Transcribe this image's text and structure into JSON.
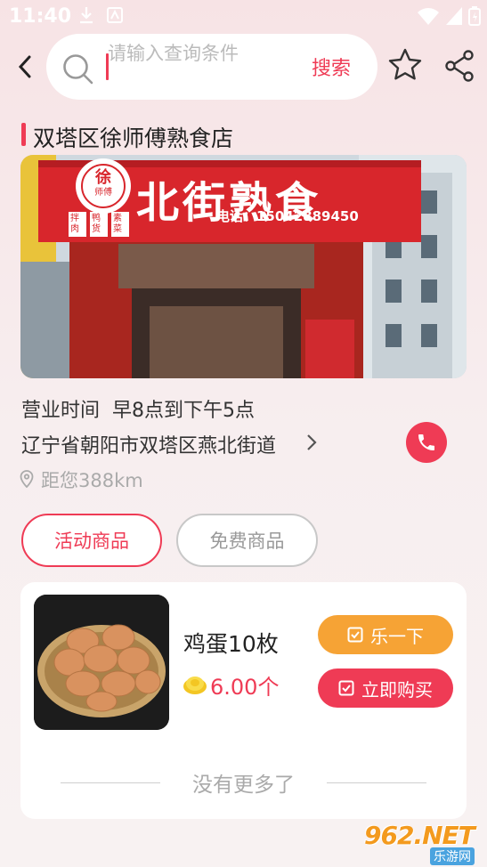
{
  "status_bar": {
    "time": "11:40"
  },
  "header": {
    "search_placeholder": "请输入查询条件",
    "search_button": "搜索"
  },
  "shop": {
    "name": "双塔区徐师傅熟食店",
    "sign_text": "北街熟食",
    "sign_logo": "徐",
    "sign_logo_sub": "师傅",
    "sign_tags": [
      "拌肉",
      "鸭货",
      "素菜"
    ],
    "sign_phone": "电话：15042889450",
    "hours": "营业时间  早8点到下午5点",
    "address": "辽宁省朝阳市双塔区燕北街道",
    "distance": "距您388km"
  },
  "tabs": [
    {
      "label": "活动商品",
      "active": true
    },
    {
      "label": "免费商品",
      "active": false
    }
  ],
  "product": {
    "name": "鸡蛋10枚",
    "price": "6.00个",
    "btn_try": "乐一下",
    "btn_buy": "立即购买"
  },
  "footer_text": "没有更多了",
  "watermark": {
    "brand": "962.NET",
    "sub": "乐游网"
  },
  "colors": {
    "accent": "#ef3b55",
    "orange": "#f6a335"
  }
}
